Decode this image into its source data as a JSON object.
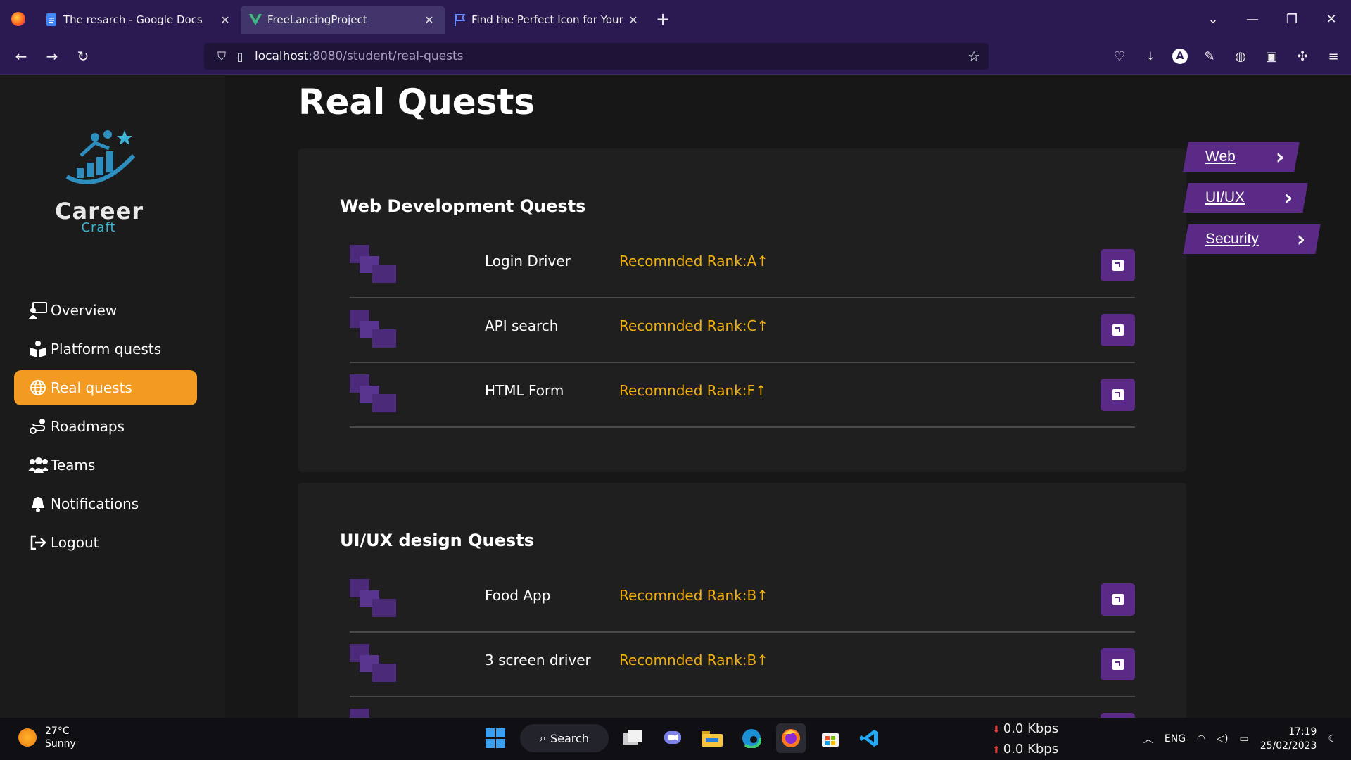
{
  "browser": {
    "tabs": [
      {
        "label": "The resarch - Google Docs",
        "icon": "google-docs-icon"
      },
      {
        "label": "FreeLancingProject",
        "icon": "vue-icon"
      },
      {
        "label": "Find the Perfect Icon for Your Pr",
        "icon": "flag-icon"
      }
    ],
    "url_host": "localhost",
    "url_path": ":8080/student/real-quests",
    "account_initial": "A"
  },
  "sidebar": {
    "logo_word": "Career",
    "logo_sub": "Craft",
    "items": [
      {
        "label": "Overview",
        "icon": "chalkboard-user-icon"
      },
      {
        "label": "Platform quests",
        "icon": "book-reader-icon"
      },
      {
        "label": "Real quests",
        "icon": "globe-icon"
      },
      {
        "label": "Roadmaps",
        "icon": "route-icon"
      },
      {
        "label": "Teams",
        "icon": "users-icon"
      },
      {
        "label": "Notifications",
        "icon": "bell-icon"
      },
      {
        "label": "Logout",
        "icon": "logout-icon"
      }
    ]
  },
  "main": {
    "title": "Real Quests",
    "sections": [
      {
        "heading": "Web Development Quests",
        "quests": [
          {
            "name": "Login Driver",
            "rank": "Recomnded Rank:A↑"
          },
          {
            "name": "API search",
            "rank": "Recomnded Rank:C↑"
          },
          {
            "name": "HTML Form",
            "rank": "Recomnded Rank:F↑"
          }
        ]
      },
      {
        "heading": "UI/UX design Quests",
        "quests": [
          {
            "name": "Food App",
            "rank": "Recomnded Rank:B↑"
          },
          {
            "name": "3 screen driver",
            "rank": "Recomnded Rank:B↑"
          }
        ]
      }
    ],
    "filters": [
      "Web",
      "UI/UX",
      "Security"
    ]
  },
  "taskbar": {
    "temp": "27°C",
    "condition": "Sunny",
    "search_label": "Search",
    "upload": "0.0 Kbps",
    "download": "0.0 Kbps",
    "lang": "ENG",
    "time": "17:19",
    "date": "25/02/2023"
  },
  "colors": {
    "accent": "#f29a22",
    "purple": "#5b2a86",
    "rank": "#f2b111",
    "chrome": "#2b1a52"
  }
}
